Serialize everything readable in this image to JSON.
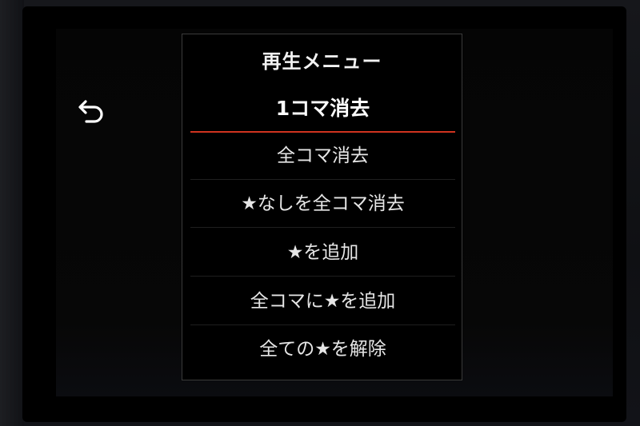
{
  "menu": {
    "title": "再生メニュー",
    "items": [
      {
        "label": "1コマ消去"
      },
      {
        "label": "全コマ消去"
      },
      {
        "label": "★なしを全コマ消去"
      },
      {
        "label": "★を追加"
      },
      {
        "label": "全コマに★を追加"
      },
      {
        "label": "全ての★を解除"
      }
    ],
    "selected_index": 0
  },
  "icons": {
    "back": "back-arrow-icon"
  },
  "colors": {
    "accent": "#d0331f",
    "text": "#e6e6e6",
    "background": "#000000"
  }
}
